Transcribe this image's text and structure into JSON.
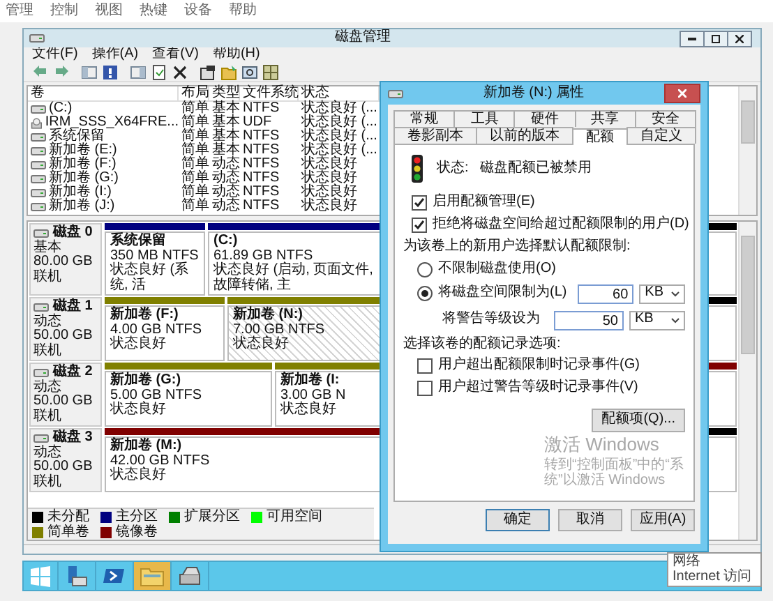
{
  "vm_menu": [
    "管理",
    "控制",
    "视图",
    "热键",
    "设备",
    "帮助"
  ],
  "window": {
    "title": "磁盘管理",
    "menu": [
      "文件(F)",
      "操作(A)",
      "查看(V)",
      "帮助(H)"
    ],
    "volumes": {
      "columns": [
        "卷",
        "布局",
        "类型",
        "文件系统",
        "状态"
      ],
      "rows": [
        {
          "kind": "drive",
          "cells": [
            "(C:)",
            "简单",
            "基本",
            "NTFS",
            "状态良好 (..."
          ]
        },
        {
          "kind": "disc",
          "cells": [
            "IRM_SSS_X64FRE...",
            "简单",
            "基本",
            "UDF",
            "状态良好 (..."
          ]
        },
        {
          "kind": "drive",
          "cells": [
            "系统保留",
            "简单",
            "基本",
            "NTFS",
            "状态良好 (..."
          ]
        },
        {
          "kind": "drive",
          "cells": [
            "新加卷 (E:)",
            "简单",
            "基本",
            "NTFS",
            "状态良好 (..."
          ]
        },
        {
          "kind": "drive",
          "cells": [
            "新加卷 (F:)",
            "简单",
            "动态",
            "NTFS",
            "状态良好"
          ]
        },
        {
          "kind": "drive",
          "cells": [
            "新加卷 (G:)",
            "简单",
            "动态",
            "NTFS",
            "状态良好"
          ]
        },
        {
          "kind": "drive",
          "cells": [
            "新加卷 (I:)",
            "简单",
            "动态",
            "NTFS",
            "状态良好"
          ]
        },
        {
          "kind": "drive",
          "cells": [
            "新加卷 (J:)",
            "简单",
            "动态",
            "NTFS",
            "状态良好"
          ]
        }
      ]
    },
    "disks": [
      {
        "name": "磁盘 0",
        "type": "基本",
        "size": "80.00 GB",
        "state": "联机",
        "partitions": [
          {
            "name": "系统保留",
            "size": "350 MB NTFS",
            "status": "状态良好 (系统, 活",
            "color": "#000080",
            "selected": false
          },
          {
            "name": "(C:)",
            "size": "61.89 GB NTFS",
            "status": "状态良好 (启动, 页面文件, 故障转储, 主",
            "color": "#000080",
            "selected": false
          },
          {
            "color": "#000000",
            "selected": false
          }
        ]
      },
      {
        "name": "磁盘 1",
        "type": "动态",
        "size": "50.00 GB",
        "state": "联机",
        "partitions": [
          {
            "name": "新加卷 (F:)",
            "size": "4.00 GB NTFS",
            "status": "状态良好",
            "color": "#808000",
            "selected": false
          },
          {
            "name": "新加卷 (N:)",
            "size": "7.00 GB NTFS",
            "status": "状态良好",
            "color": "#808000",
            "selected": true
          },
          {
            "color": "#000000",
            "selected": false
          }
        ]
      },
      {
        "name": "磁盘 2",
        "type": "动态",
        "size": "50.00 GB",
        "state": "联机",
        "partitions": [
          {
            "name": "新加卷 (G:)",
            "size": "5.00 GB NTFS",
            "status": "状态良好",
            "color": "#808000",
            "selected": false
          },
          {
            "name": "新加卷 (I:",
            "size": "3.00 GB N",
            "status": "状态良好",
            "color": "#808000",
            "selected": false
          },
          {
            "color": "#800000",
            "selected": false
          }
        ]
      },
      {
        "name": "磁盘 3",
        "type": "动态",
        "size": "50.00 GB",
        "state": "联机",
        "partitions": [
          {
            "name": "新加卷 (M:)",
            "size": "42.00 GB NTFS",
            "status": "状态良好",
            "color": "#800000",
            "selected": false
          },
          {
            "color": "#000000",
            "selected": false
          }
        ]
      }
    ],
    "legend": [
      {
        "label": "未分配",
        "color": "#000000"
      },
      {
        "label": "主分区",
        "color": "#000080"
      },
      {
        "label": "扩展分区",
        "color": "#008000"
      },
      {
        "label": "可用空间",
        "color": "#00ff00"
      },
      {
        "label": "简单卷",
        "color": "#808000"
      },
      {
        "label": "镜像卷",
        "color": "#800000"
      }
    ]
  },
  "dialog": {
    "title": "新加卷 (N:) 属性",
    "tab_rows": [
      [
        {
          "label": "常规",
          "selected": false
        },
        {
          "label": "工具",
          "selected": false
        },
        {
          "label": "硬件",
          "selected": false
        },
        {
          "label": "共享",
          "selected": false
        },
        {
          "label": "安全",
          "selected": false
        }
      ],
      [
        {
          "label": "卷影副本",
          "selected": false
        },
        {
          "label": "以前的版本",
          "selected": false
        },
        {
          "label": "配额",
          "selected": true
        },
        {
          "label": "自定义",
          "selected": false
        }
      ]
    ],
    "status_label": "状态:",
    "status": "磁盘配额已被禁用",
    "options": [
      {
        "label": "启用配额管理(E)",
        "checked": true
      },
      {
        "label": "拒绝将磁盘空间给超过配额限制的用户(D)",
        "checked": true
      }
    ],
    "default_heading": "为该卷上的新用户选择默认配额限制:",
    "limit_choices": [
      {
        "label": "不限制磁盘使用(O)",
        "selected": false
      },
      {
        "label": "将磁盘空间限制为(L)",
        "selected": true,
        "value": "60",
        "unit": "KB"
      }
    ],
    "warning": {
      "label": "将警告等级设为",
      "value": "50",
      "unit": "KB"
    },
    "log_heading": "选择该卷的配额记录选项:",
    "log_options": [
      {
        "label": "用户超出配额限制时记录事件(G)",
        "checked": false
      },
      {
        "label": "用户超过警告等级时记录事件(V)",
        "checked": false
      }
    ],
    "entries_button": "配额项(Q)...",
    "buttons": [
      "确定",
      "取消",
      "应用(A)"
    ]
  },
  "taskbar": [
    {
      "kind": "start",
      "selected": false
    },
    {
      "kind": "server",
      "selected": false
    },
    {
      "kind": "shell",
      "selected": false
    },
    {
      "kind": "folder",
      "selected": true
    },
    {
      "kind": "disk",
      "selected": false
    }
  ],
  "tooltip": [
    "网络",
    "Internet 访问"
  ],
  "activation": {
    "title": "激活 Windows",
    "hint": "转到“控制面板”中的“系统”以激活 Windows"
  }
}
